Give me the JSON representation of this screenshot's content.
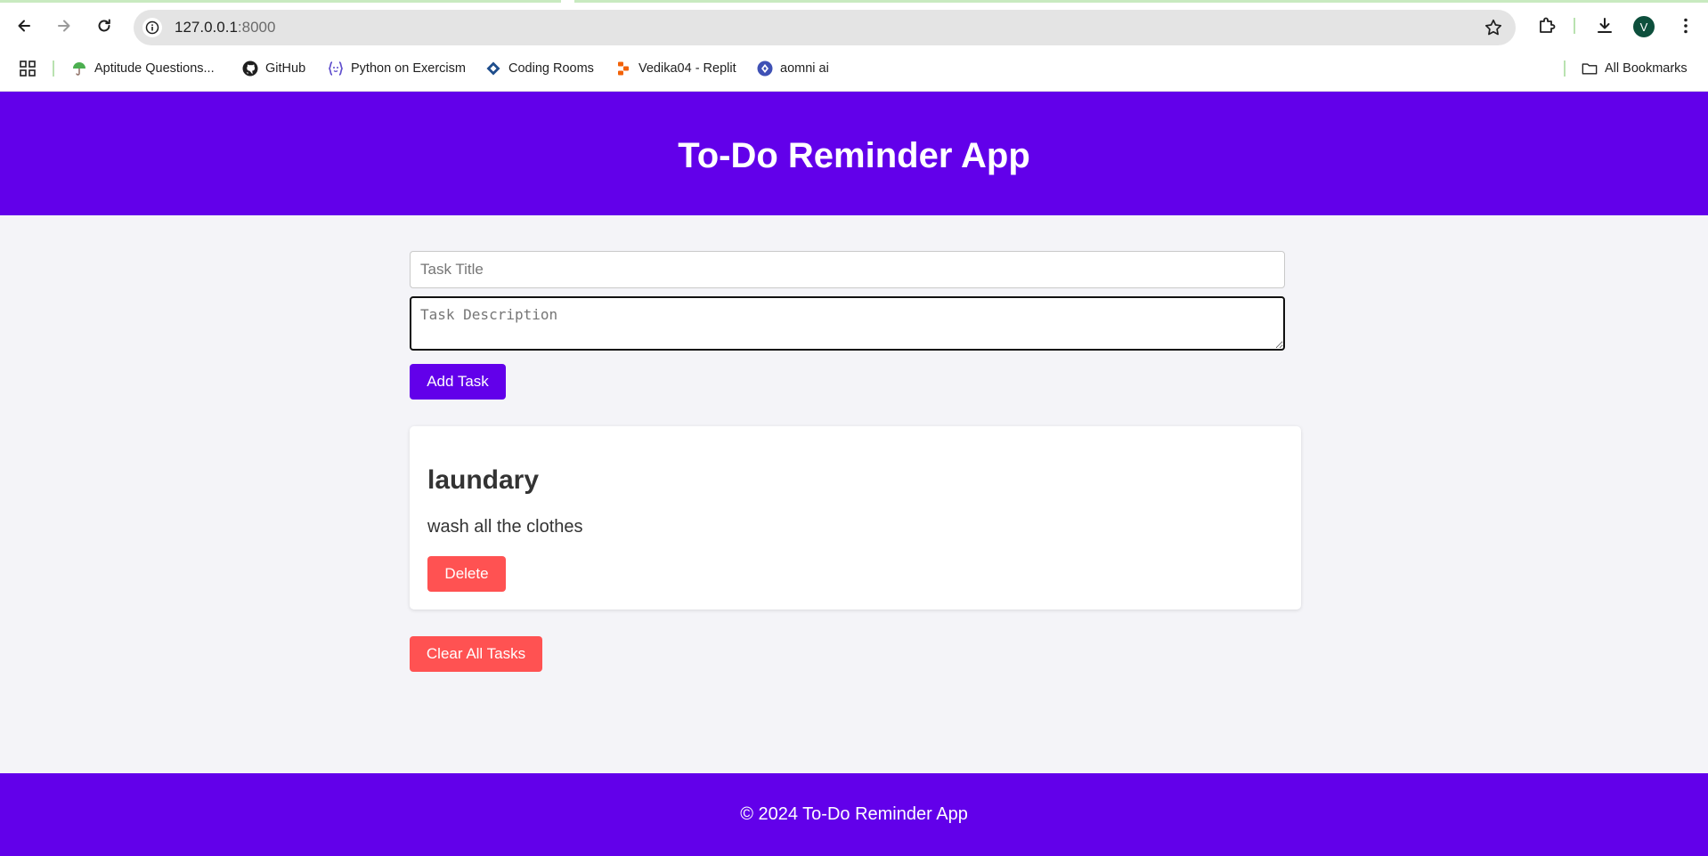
{
  "browser": {
    "url_host": "127.0.0.1",
    "url_port": ":8000",
    "avatar_letter": "V",
    "bookmarks": [
      {
        "label": "Aptitude Questions...",
        "icon": "umbrella-icon"
      },
      {
        "label": "GitHub",
        "icon": "github-icon"
      },
      {
        "label": "Python on Exercism",
        "icon": "exercism-icon"
      },
      {
        "label": "Coding Rooms",
        "icon": "coding-rooms-icon"
      },
      {
        "label": "Vedika04 - Replit",
        "icon": "replit-icon"
      },
      {
        "label": "aomni ai",
        "icon": "aomni-icon"
      }
    ],
    "all_bookmarks_label": "All Bookmarks"
  },
  "app": {
    "title": "To-Do Reminder App",
    "form": {
      "title_placeholder": "Task Title",
      "title_value": "",
      "description_placeholder": "Task Description",
      "description_value": "",
      "add_label": "Add Task"
    },
    "tasks": [
      {
        "title": "laundary",
        "description": "wash all the clothes",
        "delete_label": "Delete"
      }
    ],
    "clear_label": "Clear All Tasks",
    "footer": "© 2024 To-Do Reminder App"
  },
  "colors": {
    "primary": "#6200ea",
    "danger": "#ff5252",
    "page_bg": "#f4f4f8"
  }
}
